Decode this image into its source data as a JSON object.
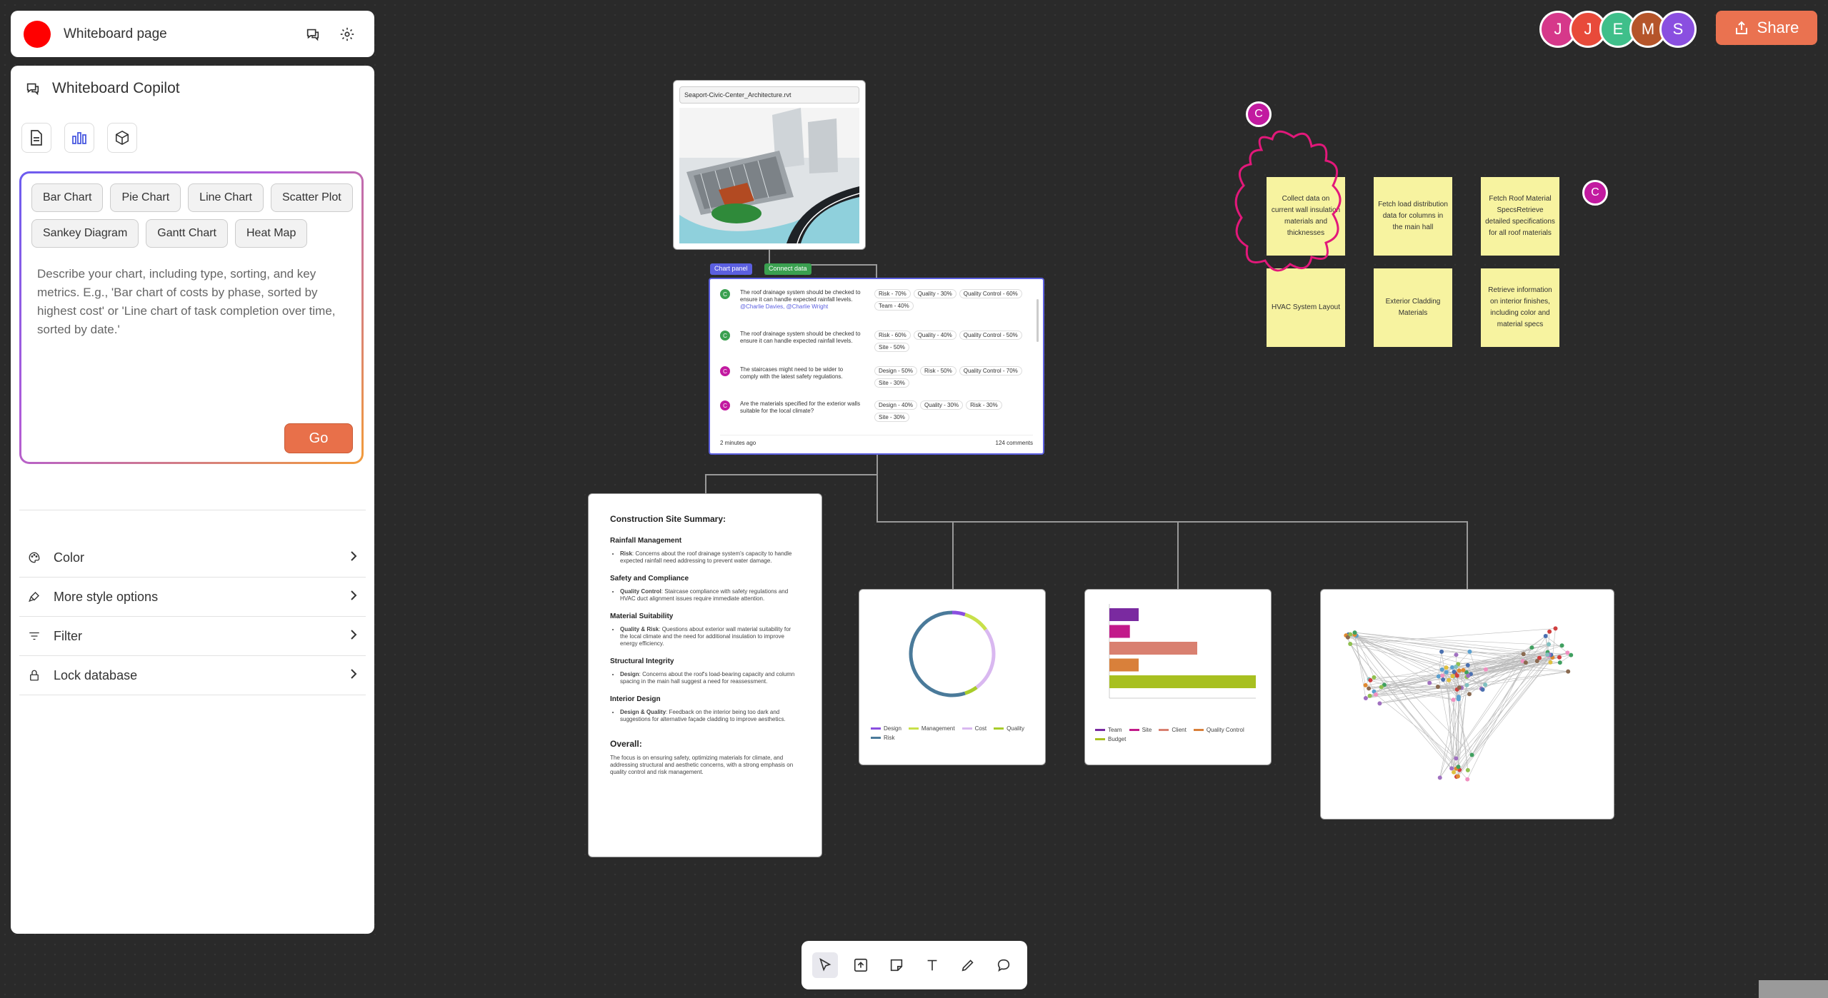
{
  "topbar": {
    "title": "Whiteboard page"
  },
  "copilot": {
    "title": "Whiteboard Copilot",
    "chips": [
      "Bar Chart",
      "Pie Chart",
      "Line Chart",
      "Scatter Plot",
      "Sankey Diagram",
      "Gantt Chart",
      "Heat Map"
    ],
    "placeholder": "Describe your chart, including type, sorting, and key metrics. E.g., 'Bar chart of costs by phase, sorted by highest cost' or 'Line chart of task completion over time, sorted by date.'",
    "go_label": "Go",
    "menu": [
      {
        "label": "Color",
        "icon": "palette-icon"
      },
      {
        "label": "More style options",
        "icon": "style-brush-icon"
      },
      {
        "label": "Filter",
        "icon": "filter-icon"
      },
      {
        "label": "Lock database",
        "icon": "lock-icon"
      }
    ]
  },
  "avatars": [
    {
      "letter": "J",
      "color": "#d6388a"
    },
    {
      "letter": "J",
      "color": "#e84a3a"
    },
    {
      "letter": "E",
      "color": "#3fbf8a"
    },
    {
      "letter": "M",
      "color": "#b5552a"
    },
    {
      "letter": "S",
      "color": "#8a4fe0"
    }
  ],
  "share_label": "Share",
  "model_card": {
    "filename": "Seaport-Civic-Center_Architecture.rvt"
  },
  "comments_panel": {
    "tab_chart": "Chart panel",
    "tab_connect": "Connect data",
    "rows": [
      {
        "avatar": "C",
        "avatar_color": "#3aa050",
        "text": "The roof drainage system should be checked to ensure it can handle expected rainfall levels.",
        "mentions": "@Charlie Davies, @Charlie Wright",
        "tags": [
          "Risk - 70%",
          "Quality - 30%",
          "Quality Control - 60%",
          "Team - 40%"
        ]
      },
      {
        "avatar": "C",
        "avatar_color": "#3aa050",
        "text": "The roof drainage system should be checked to ensure it can handle expected rainfall levels.",
        "mentions": "",
        "tags": [
          "Risk - 60%",
          "Quality - 40%",
          "Quality Control - 50%",
          "Site - 50%"
        ]
      },
      {
        "avatar": "C",
        "avatar_color": "#c21aa0",
        "text": "The staircases might need to be wider to comply with the latest safety regulations.",
        "mentions": "",
        "tags": [
          "Design - 50%",
          "Risk - 50%",
          "Quality Control - 70%",
          "Site - 30%"
        ]
      },
      {
        "avatar": "C",
        "avatar_color": "#c21aa0",
        "text": "Are the materials specified for the exterior walls suitable for the local climate?",
        "mentions": "",
        "tags": [
          "Design - 40%",
          "Quality - 30%",
          "Risk - 30%",
          "Site - 30%"
        ]
      }
    ],
    "footer_left": "2 minutes ago",
    "footer_right": "124 comments"
  },
  "summary": {
    "title": "Construction Site Summary:",
    "sections": [
      {
        "heading": "Rainfall Management",
        "label": "Risk",
        "text": ": Concerns about the roof drainage system's capacity to handle expected rainfall need addressing to prevent water damage."
      },
      {
        "heading": "Safety and Compliance",
        "label": "Quality Control",
        "text": ": Staircase compliance with safety regulations and HVAC duct alignment issues require immediate attention."
      },
      {
        "heading": "Material Suitability",
        "label": "Quality & Risk",
        "text": ": Questions about exterior wall material suitability for the local climate and the need for additional insulation to improve energy efficiency."
      },
      {
        "heading": "Structural Integrity",
        "label": "Design",
        "text": ": Concerns about the roof's load-bearing capacity and column spacing in the main hall suggest a need for reassessment."
      },
      {
        "heading": "Interior Design",
        "label": "Design & Quality",
        "text": ": Feedback on the interior being too dark and suggestions for alternative façade cladding to improve aesthetics."
      }
    ],
    "overall_heading": "Overall:",
    "overall_text": "The focus is on ensuring safety, optimizing materials for climate, and addressing structural and aesthetic concerns, with a strong emphasis on quality control and risk management."
  },
  "donut_legend": [
    {
      "name": "Design",
      "color": "#8a4fe0"
    },
    {
      "name": "Management",
      "color": "#c8e04a"
    },
    {
      "name": "Cost",
      "color": "#d9b8f0"
    },
    {
      "name": "Quality",
      "color": "#a8cc2a"
    },
    {
      "name": "Risk",
      "color": "#4a7a9a"
    }
  ],
  "bar_legend": [
    {
      "name": "Team",
      "color": "#7a2aa0"
    },
    {
      "name": "Site",
      "color": "#c21a8a"
    },
    {
      "name": "Client",
      "color": "#d98070"
    },
    {
      "name": "Quality Control",
      "color": "#d9803a"
    },
    {
      "name": "Budget",
      "color": "#a8c020"
    }
  ],
  "chart_data": [
    {
      "type": "pie",
      "categories": [
        "Design",
        "Management",
        "Cost",
        "Quality",
        "Risk"
      ],
      "values": [
        5,
        10,
        25,
        5,
        55
      ],
      "colors": [
        "#8a4fe0",
        "#c8e04a",
        "#d9b8f0",
        "#a8cc2a",
        "#4a7a9a"
      ]
    },
    {
      "type": "bar",
      "orientation": "horizontal",
      "categories": [
        "Team",
        "Site",
        "Client",
        "Quality Control",
        "Budget"
      ],
      "values": [
        50,
        35,
        150,
        50,
        250
      ],
      "xlim": [
        0,
        250
      ],
      "colors": [
        "#7a2aa0",
        "#c21a8a",
        "#d98070",
        "#d9803a",
        "#a8c020"
      ]
    }
  ],
  "stickies": [
    "Collect data on current wall insulation materials and thicknesses",
    "Fetch load distribution data for columns in the main hall",
    "Fetch Roof Material SpecsRetrieve detailed specifications for all roof materials",
    "HVAC System Layout",
    "Exterior Cladding Materials",
    "Retrieve information on interior finishes, including color and material specs"
  ],
  "badge_letter": "C",
  "bottom_tools": [
    {
      "name": "select-pointer-icon"
    },
    {
      "name": "upload-icon"
    },
    {
      "name": "sticky-note-icon"
    },
    {
      "name": "text-tool-icon"
    },
    {
      "name": "pen-icon"
    },
    {
      "name": "comment-icon"
    }
  ]
}
